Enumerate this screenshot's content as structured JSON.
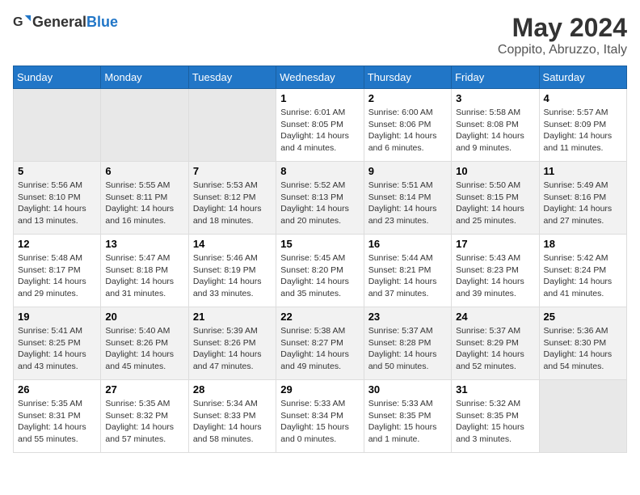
{
  "header": {
    "logo_general": "General",
    "logo_blue": "Blue",
    "title": "May 2024",
    "subtitle": "Coppito, Abruzzo, Italy"
  },
  "weekdays": [
    "Sunday",
    "Monday",
    "Tuesday",
    "Wednesday",
    "Thursday",
    "Friday",
    "Saturday"
  ],
  "weeks": [
    [
      {
        "day": "",
        "info": ""
      },
      {
        "day": "",
        "info": ""
      },
      {
        "day": "",
        "info": ""
      },
      {
        "day": "1",
        "info": "Sunrise: 6:01 AM\nSunset: 8:05 PM\nDaylight: 14 hours\nand 4 minutes."
      },
      {
        "day": "2",
        "info": "Sunrise: 6:00 AM\nSunset: 8:06 PM\nDaylight: 14 hours\nand 6 minutes."
      },
      {
        "day": "3",
        "info": "Sunrise: 5:58 AM\nSunset: 8:08 PM\nDaylight: 14 hours\nand 9 minutes."
      },
      {
        "day": "4",
        "info": "Sunrise: 5:57 AM\nSunset: 8:09 PM\nDaylight: 14 hours\nand 11 minutes."
      }
    ],
    [
      {
        "day": "5",
        "info": "Sunrise: 5:56 AM\nSunset: 8:10 PM\nDaylight: 14 hours\nand 13 minutes."
      },
      {
        "day": "6",
        "info": "Sunrise: 5:55 AM\nSunset: 8:11 PM\nDaylight: 14 hours\nand 16 minutes."
      },
      {
        "day": "7",
        "info": "Sunrise: 5:53 AM\nSunset: 8:12 PM\nDaylight: 14 hours\nand 18 minutes."
      },
      {
        "day": "8",
        "info": "Sunrise: 5:52 AM\nSunset: 8:13 PM\nDaylight: 14 hours\nand 20 minutes."
      },
      {
        "day": "9",
        "info": "Sunrise: 5:51 AM\nSunset: 8:14 PM\nDaylight: 14 hours\nand 23 minutes."
      },
      {
        "day": "10",
        "info": "Sunrise: 5:50 AM\nSunset: 8:15 PM\nDaylight: 14 hours\nand 25 minutes."
      },
      {
        "day": "11",
        "info": "Sunrise: 5:49 AM\nSunset: 8:16 PM\nDaylight: 14 hours\nand 27 minutes."
      }
    ],
    [
      {
        "day": "12",
        "info": "Sunrise: 5:48 AM\nSunset: 8:17 PM\nDaylight: 14 hours\nand 29 minutes."
      },
      {
        "day": "13",
        "info": "Sunrise: 5:47 AM\nSunset: 8:18 PM\nDaylight: 14 hours\nand 31 minutes."
      },
      {
        "day": "14",
        "info": "Sunrise: 5:46 AM\nSunset: 8:19 PM\nDaylight: 14 hours\nand 33 minutes."
      },
      {
        "day": "15",
        "info": "Sunrise: 5:45 AM\nSunset: 8:20 PM\nDaylight: 14 hours\nand 35 minutes."
      },
      {
        "day": "16",
        "info": "Sunrise: 5:44 AM\nSunset: 8:21 PM\nDaylight: 14 hours\nand 37 minutes."
      },
      {
        "day": "17",
        "info": "Sunrise: 5:43 AM\nSunset: 8:23 PM\nDaylight: 14 hours\nand 39 minutes."
      },
      {
        "day": "18",
        "info": "Sunrise: 5:42 AM\nSunset: 8:24 PM\nDaylight: 14 hours\nand 41 minutes."
      }
    ],
    [
      {
        "day": "19",
        "info": "Sunrise: 5:41 AM\nSunset: 8:25 PM\nDaylight: 14 hours\nand 43 minutes."
      },
      {
        "day": "20",
        "info": "Sunrise: 5:40 AM\nSunset: 8:26 PM\nDaylight: 14 hours\nand 45 minutes."
      },
      {
        "day": "21",
        "info": "Sunrise: 5:39 AM\nSunset: 8:26 PM\nDaylight: 14 hours\nand 47 minutes."
      },
      {
        "day": "22",
        "info": "Sunrise: 5:38 AM\nSunset: 8:27 PM\nDaylight: 14 hours\nand 49 minutes."
      },
      {
        "day": "23",
        "info": "Sunrise: 5:37 AM\nSunset: 8:28 PM\nDaylight: 14 hours\nand 50 minutes."
      },
      {
        "day": "24",
        "info": "Sunrise: 5:37 AM\nSunset: 8:29 PM\nDaylight: 14 hours\nand 52 minutes."
      },
      {
        "day": "25",
        "info": "Sunrise: 5:36 AM\nSunset: 8:30 PM\nDaylight: 14 hours\nand 54 minutes."
      }
    ],
    [
      {
        "day": "26",
        "info": "Sunrise: 5:35 AM\nSunset: 8:31 PM\nDaylight: 14 hours\nand 55 minutes."
      },
      {
        "day": "27",
        "info": "Sunrise: 5:35 AM\nSunset: 8:32 PM\nDaylight: 14 hours\nand 57 minutes."
      },
      {
        "day": "28",
        "info": "Sunrise: 5:34 AM\nSunset: 8:33 PM\nDaylight: 14 hours\nand 58 minutes."
      },
      {
        "day": "29",
        "info": "Sunrise: 5:33 AM\nSunset: 8:34 PM\nDaylight: 15 hours\nand 0 minutes."
      },
      {
        "day": "30",
        "info": "Sunrise: 5:33 AM\nSunset: 8:35 PM\nDaylight: 15 hours\nand 1 minute."
      },
      {
        "day": "31",
        "info": "Sunrise: 5:32 AM\nSunset: 8:35 PM\nDaylight: 15 hours\nand 3 minutes."
      },
      {
        "day": "",
        "info": ""
      }
    ]
  ]
}
